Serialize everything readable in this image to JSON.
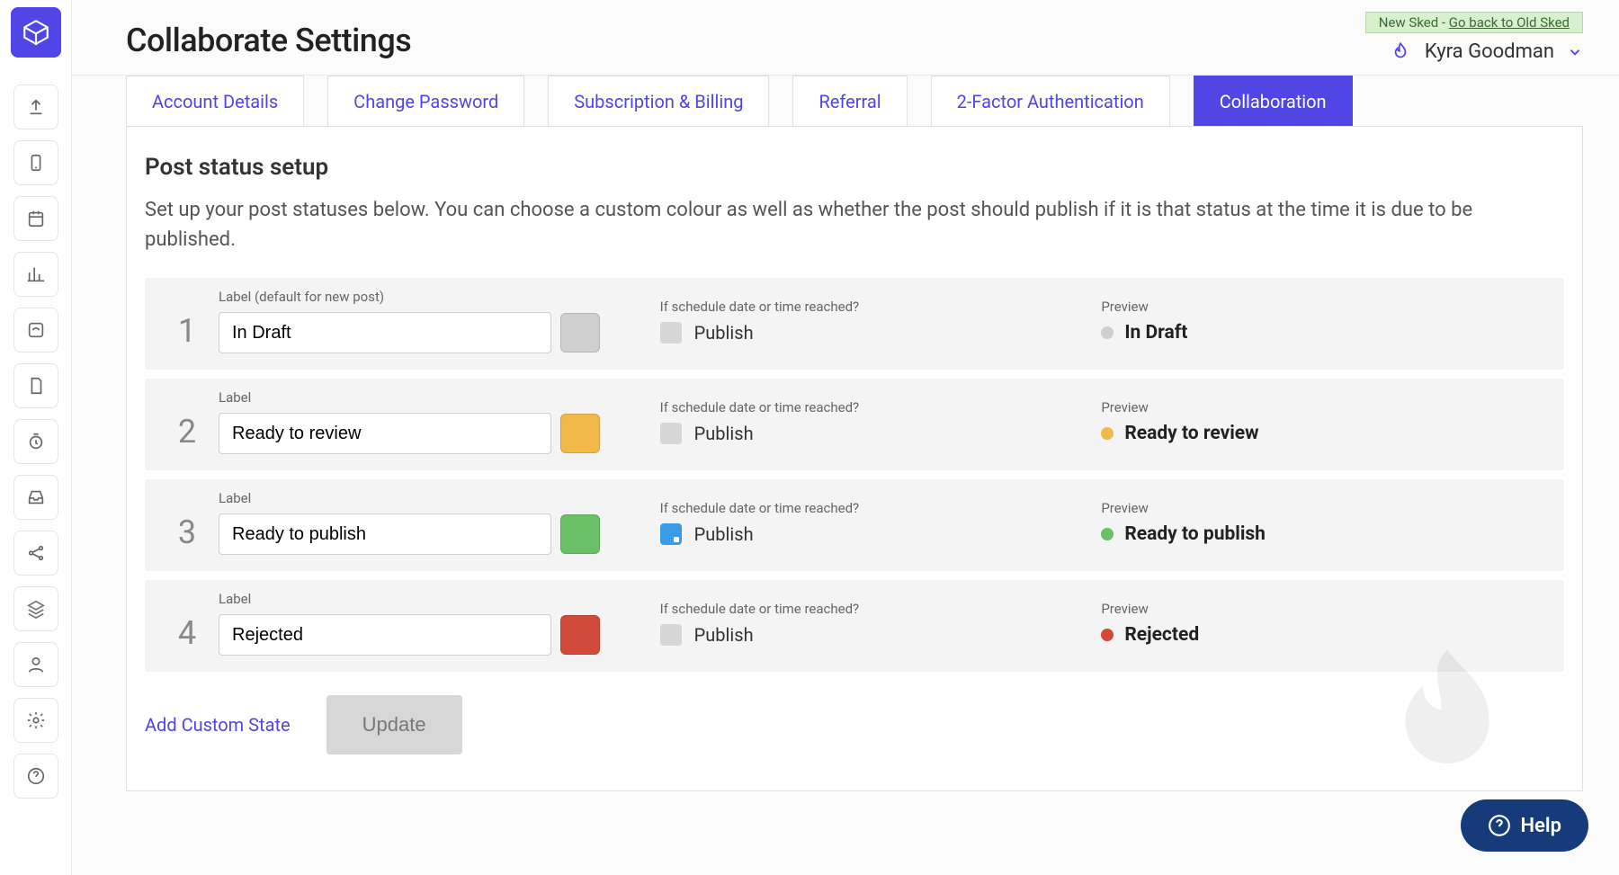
{
  "header": {
    "title": "Collaborate Settings",
    "banner_prefix": "New Sked - ",
    "banner_link": "Go back to Old Sked",
    "user_name": "Kyra Goodman"
  },
  "tabs": [
    {
      "label": "Account Details",
      "active": false
    },
    {
      "label": "Change Password",
      "active": false
    },
    {
      "label": "Subscription & Billing",
      "active": false
    },
    {
      "label": "Referral",
      "active": false
    },
    {
      "label": "2-Factor Authentication",
      "active": false
    },
    {
      "label": "Collaboration",
      "active": true
    }
  ],
  "section": {
    "title": "Post status setup",
    "description": "Set up your post statuses below. You can choose a custom colour as well as whether the post should publish if it is that status at the time it is due to be published."
  },
  "columns": {
    "label_default": "Label (default for new post)",
    "label": "Label",
    "schedule": "If schedule date or time reached?",
    "publish": "Publish",
    "preview": "Preview"
  },
  "statuses": [
    {
      "index": "1",
      "label": "In Draft",
      "color": "#cfcfcf",
      "publish_checked": false,
      "preview_color": "#cfcfcf",
      "is_default": true
    },
    {
      "index": "2",
      "label": "Ready to review",
      "color": "#f0b94a",
      "publish_checked": false,
      "preview_color": "#f0b94a",
      "is_default": false
    },
    {
      "index": "3",
      "label": "Ready to publish",
      "color": "#6bbf68",
      "publish_checked": true,
      "preview_color": "#6bbf68",
      "is_default": false
    },
    {
      "index": "4",
      "label": "Rejected",
      "color": "#d24a3c",
      "publish_checked": false,
      "preview_color": "#d24a3c",
      "is_default": false
    }
  ],
  "actions": {
    "add_custom": "Add Custom State",
    "update": "Update"
  },
  "help": {
    "label": "Help"
  }
}
